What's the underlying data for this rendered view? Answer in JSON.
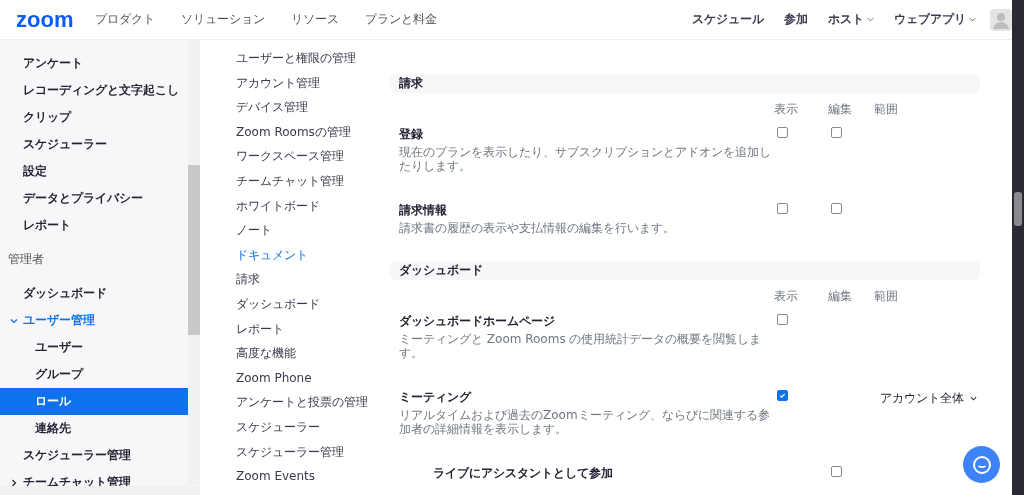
{
  "header": {
    "logo": "zoom",
    "nav": [
      "プロダクト",
      "ソリューション",
      "リソース",
      "プランと料金"
    ],
    "actions": [
      {
        "label": "スケジュール",
        "dropdown": false
      },
      {
        "label": "参加",
        "dropdown": false
      },
      {
        "label": "ホスト",
        "dropdown": true
      },
      {
        "label": "ウェブアプリ",
        "dropdown": true
      }
    ]
  },
  "sidebar": {
    "items": [
      {
        "kind": "item",
        "label": "アンケート",
        "selected": false
      },
      {
        "kind": "item",
        "label": "レコーディングと文字起こし",
        "selected": false
      },
      {
        "kind": "item",
        "label": "クリップ",
        "selected": false
      },
      {
        "kind": "item",
        "label": "スケジューラー",
        "selected": false
      },
      {
        "kind": "item",
        "label": "設定",
        "selected": false
      },
      {
        "kind": "item",
        "label": "データとプライバシー",
        "selected": false
      },
      {
        "kind": "item",
        "label": "レポート",
        "selected": false
      },
      {
        "kind": "heading",
        "label": "管理者"
      },
      {
        "kind": "item",
        "label": "ダッシュボード",
        "selected": false
      },
      {
        "kind": "group",
        "label": "ユーザー管理",
        "expanded": true,
        "selected": false,
        "children": [
          {
            "kind": "item",
            "label": "ユーザー",
            "selected": false
          },
          {
            "kind": "item",
            "label": "グループ",
            "selected": false
          },
          {
            "kind": "item",
            "label": "ロール",
            "selected": true
          },
          {
            "kind": "item",
            "label": "連絡先",
            "selected": false
          }
        ]
      },
      {
        "kind": "item",
        "label": "スケジューラー管理",
        "selected": false
      },
      {
        "kind": "group",
        "label": "チームチャット管理",
        "expanded": false,
        "selected": false
      }
    ]
  },
  "section_nav": [
    {
      "label": "ユーザーと権限の管理",
      "selected": false
    },
    {
      "label": "アカウント管理",
      "selected": false
    },
    {
      "label": "デバイス管理",
      "selected": false
    },
    {
      "label": "Zoom Roomsの管理",
      "selected": false
    },
    {
      "label": "ワークスペース管理",
      "selected": false
    },
    {
      "label": "チームチャット管理",
      "selected": false
    },
    {
      "label": "ホワイトボード",
      "selected": false
    },
    {
      "label": "ノート",
      "selected": false
    },
    {
      "label": "ドキュメント",
      "selected": true
    },
    {
      "label": "請求",
      "selected": false
    },
    {
      "label": "ダッシュボード",
      "selected": false
    },
    {
      "label": "レポート",
      "selected": false
    },
    {
      "label": "高度な機能",
      "selected": false
    },
    {
      "label": "Zoom Phone",
      "selected": false
    },
    {
      "label": "アンケートと投票の管理",
      "selected": false
    },
    {
      "label": "スケジューラー",
      "selected": false
    },
    {
      "label": "スケジューラー管理",
      "selected": false
    },
    {
      "label": "Zoom Events",
      "selected": false
    }
  ],
  "sections": [
    {
      "title": "請求",
      "columns": [
        "表示",
        "編集",
        "範囲"
      ],
      "rows": [
        {
          "title": "登録",
          "description": "現在のプランを表示したり、サブスクリプションとアドオンを追加したりします。",
          "kind": "permission",
          "view": {
            "checked": false
          },
          "edit": {
            "checked": false
          }
        },
        {
          "title": "請求情報",
          "kind": "permission",
          "description": "請求書の履歴の表示や支払情報の編集を行います。",
          "view": {
            "checked": false
          },
          "edit": {
            "checked": false
          }
        }
      ]
    },
    {
      "title": "ダッシュボード",
      "columns": [
        "表示",
        "編集",
        "範囲"
      ],
      "rows": [
        {
          "title": "ダッシュボードホームページ",
          "description": "ミーティングと Zoom Rooms の使用統計データの概要を閲覧します。",
          "kind": "permission",
          "view": {
            "checked": false
          }
        },
        {
          "title": "ミーティング",
          "description": "リアルタイムおよび過去のZoomミーティング、ならびに関連する参加者の詳細情報を表示します。",
          "kind": "permission",
          "view": {
            "checked": true
          },
          "scope": "アカウント全体"
        },
        {
          "title": "ライブにアシスタントとして参加",
          "kind": "sub-permission",
          "edit": {
            "checked": false
          }
        }
      ]
    }
  ]
}
